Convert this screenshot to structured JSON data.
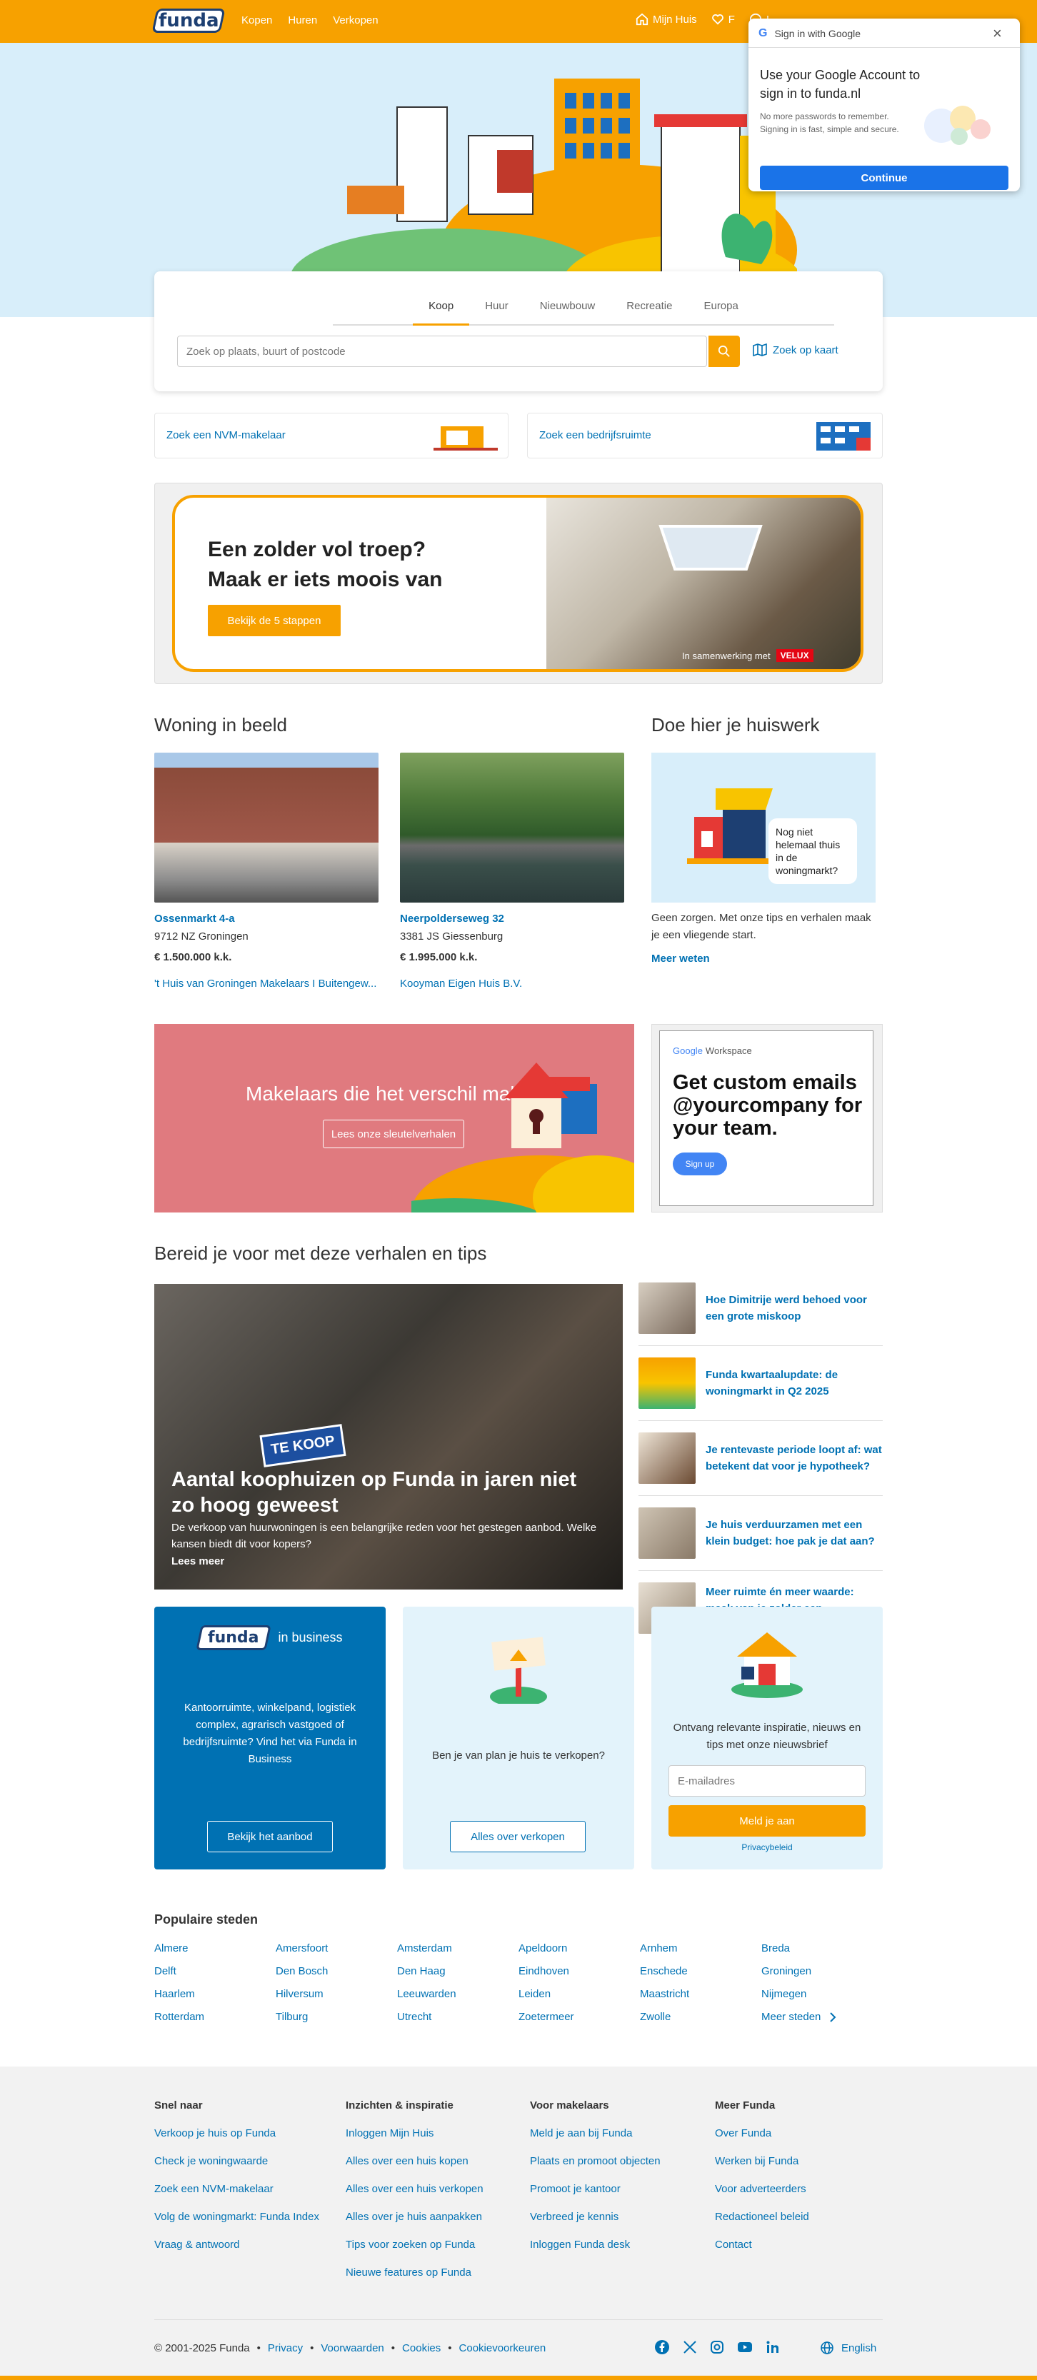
{
  "header": {
    "logo": "funda",
    "nav": [
      "Kopen",
      "Huren",
      "Verkopen"
    ],
    "my_house": "Mijn Huis",
    "favorites": "F",
    "login": "I"
  },
  "google": {
    "title": "Sign in with Google",
    "heading": "Use your Google Account to sign in to funda.nl",
    "desc": "No more passwords to remember. Signing in is fast, simple and secure.",
    "button": "Continue"
  },
  "search": {
    "tabs": [
      "Koop",
      "Huur",
      "Nieuwbouw",
      "Recreatie",
      "Europa"
    ],
    "active_tab": "Koop",
    "placeholder": "Zoek op plaats, buurt of postcode",
    "map_link": "Zoek op kaart"
  },
  "quick_links": [
    "Zoek een NVM-makelaar",
    "Zoek een bedrijfsruimte"
  ],
  "ad1": {
    "line1": "Een zolder vol troep?",
    "line2": "Maak er iets moois van",
    "button": "Bekijk de 5 stappen",
    "credit": "In samenwerking met",
    "brand": "VELUX"
  },
  "woning": {
    "title": "Woning in beeld",
    "listings": [
      {
        "street": "Ossenmarkt 4-a",
        "city": "9712 NZ Groningen",
        "price": "€ 1.500.000 k.k.",
        "agent": "'t Huis van Groningen Makelaars I Buitengew..."
      },
      {
        "street": "Neerpolderseweg 32",
        "city": "3381 JS Giessenburg",
        "price": "€ 1.995.000 k.k.",
        "agent": "Kooyman Eigen Huis B.V."
      }
    ]
  },
  "huiswerk": {
    "title": "Doe hier je huiswerk",
    "bubble": "Nog niet helemaal thuis in de woningmarkt?",
    "text": "Geen zorgen. Met onze tips en verhalen maak je een vliegende start.",
    "link": "Meer weten"
  },
  "makelaars": {
    "title": "Makelaars die het verschil maken",
    "button": "Lees onze sleutelverhalen"
  },
  "ad2": {
    "brand_google": "Google",
    "brand_ws": "Workspace",
    "text": "Get custom emails @yourcompany for your team.",
    "button": "Sign up"
  },
  "stories": {
    "title": "Bereid je voor met deze verhalen en tips",
    "main_title": "Aantal koophuizen op Funda in jaren niet zo hoog geweest",
    "main_text": "De verkoop van huurwoningen is een belangrijke reden voor het gestegen aanbod. Welke kansen biedt dit voor kopers?",
    "main_link": "Lees meer",
    "sign": "TE KOOP",
    "items": [
      "Hoe Dimitrije werd behoed voor een grote miskoop",
      "Funda kwartaalupdate: de woningmarkt in Q2 2025",
      "Je rentevaste periode loopt af: wat betekent dat voor je hypotheek?",
      "Je huis verduurzamen met een klein budget: hoe pak je dat aan?",
      "Meer ruimte én meer waarde: maak van je zolder een volwaardige woonruimte"
    ]
  },
  "business": {
    "logo": "funda",
    "suffix": "in business",
    "text": "Kantoorruimte, winkelpand, logistiek complex, agrarisch vastgoed of bedrijfsruimte? Vind het via Funda in Business",
    "button": "Bekijk het aanbod"
  },
  "verkopen": {
    "text": "Ben je van plan je huis te verkopen?",
    "button": "Alles over verkopen"
  },
  "newsletter": {
    "text": "Ontvang relevante inspiratie, nieuws en tips met onze nieuwsbrief",
    "placeholder": "E-mailadres",
    "button": "Meld je aan",
    "privacy": "Privacybeleid"
  },
  "cities": {
    "title": "Populaire steden",
    "list": [
      "Almere",
      "Amersfoort",
      "Amsterdam",
      "Apeldoorn",
      "Arnhem",
      "Breda",
      "Delft",
      "Den Bosch",
      "Den Haag",
      "Eindhoven",
      "Enschede",
      "Groningen",
      "Haarlem",
      "Hilversum",
      "Leeuwarden",
      "Leiden",
      "Maastricht",
      "Nijmegen",
      "Rotterdam",
      "Tilburg",
      "Utrecht",
      "Zoetermeer",
      "Zwolle",
      "Meer steden"
    ]
  },
  "footer": {
    "cols": [
      {
        "title": "Snel naar",
        "links": [
          "Verkoop je huis op Funda",
          "Check je woningwaarde",
          "Zoek een NVM-makelaar",
          "Volg de woningmarkt: Funda Index",
          "Vraag & antwoord"
        ]
      },
      {
        "title": "Inzichten & inspiratie",
        "links": [
          "Inloggen Mijn Huis",
          "Alles over een huis kopen",
          "Alles over een huis verkopen",
          "Alles over je huis aanpakken",
          "Tips voor zoeken op Funda",
          "Nieuwe features op Funda"
        ]
      },
      {
        "title": "Voor makelaars",
        "links": [
          "Meld je aan bij Funda",
          "Plaats en promoot objecten",
          "Promoot je kantoor",
          "Verbreed je kennis",
          "Inloggen Funda desk"
        ]
      },
      {
        "title": "Meer Funda",
        "links": [
          "Over Funda",
          "Werken bij Funda",
          "Voor adverteerders",
          "Redactioneel beleid",
          "Contact"
        ]
      }
    ],
    "copyright": "© 2001-2025 Funda",
    "legal": [
      "Privacy",
      "Voorwaarden",
      "Cookies",
      "Cookievoorkeuren"
    ],
    "language": "English"
  },
  "colors": {
    "brand": "#f7a100",
    "link": "#0071b3",
    "navy": "#1d3f72",
    "business": "#0071b3"
  }
}
